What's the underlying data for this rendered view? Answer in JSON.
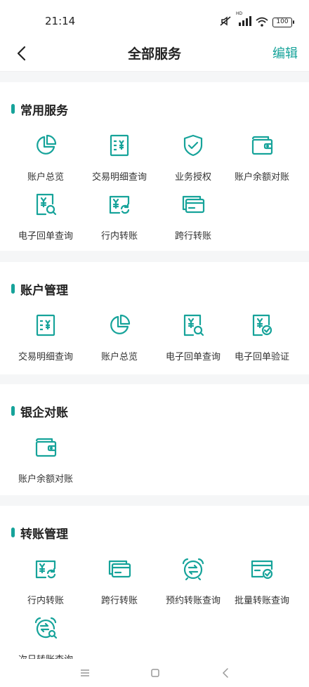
{
  "status": {
    "time": "21:14",
    "battery": "100",
    "hd_label": "HD"
  },
  "nav": {
    "title": "全部服务",
    "edit_label": "编辑"
  },
  "colors": {
    "accent": "#16a39a",
    "background": "#f5f6f7"
  },
  "sections": [
    {
      "title": "常用服务",
      "items": [
        {
          "label": "账户总览",
          "icon": "pie-chart-icon"
        },
        {
          "label": "交易明细查询",
          "icon": "yuan-document-icon"
        },
        {
          "label": "业务授权",
          "icon": "shield-check-icon"
        },
        {
          "label": "账户余额对账",
          "icon": "wallet-icon"
        },
        {
          "label": "电子回单查询",
          "icon": "receipt-search-icon"
        },
        {
          "label": "行内转账",
          "icon": "yuan-refresh-icon"
        },
        {
          "label": "跨行转账",
          "icon": "cards-transfer-icon"
        }
      ]
    },
    {
      "title": "账户管理",
      "items": [
        {
          "label": "交易明细查询",
          "icon": "yuan-document-icon"
        },
        {
          "label": "账户总览",
          "icon": "pie-chart-icon"
        },
        {
          "label": "电子回单查询",
          "icon": "receipt-search-icon"
        },
        {
          "label": "电子回单验证",
          "icon": "receipt-check-icon"
        }
      ]
    },
    {
      "title": "银企对账",
      "items": [
        {
          "label": "账户余额对账",
          "icon": "wallet-icon"
        }
      ]
    },
    {
      "title": "转账管理",
      "items": [
        {
          "label": "行内转账",
          "icon": "yuan-refresh-icon"
        },
        {
          "label": "跨行转账",
          "icon": "cards-transfer-icon"
        },
        {
          "label": "预约转账查询",
          "icon": "alarm-transfer-icon"
        },
        {
          "label": "批量转账查询",
          "icon": "card-check-icon"
        },
        {
          "label": "次日转账查询",
          "icon": "alarm-search-icon"
        }
      ]
    }
  ]
}
